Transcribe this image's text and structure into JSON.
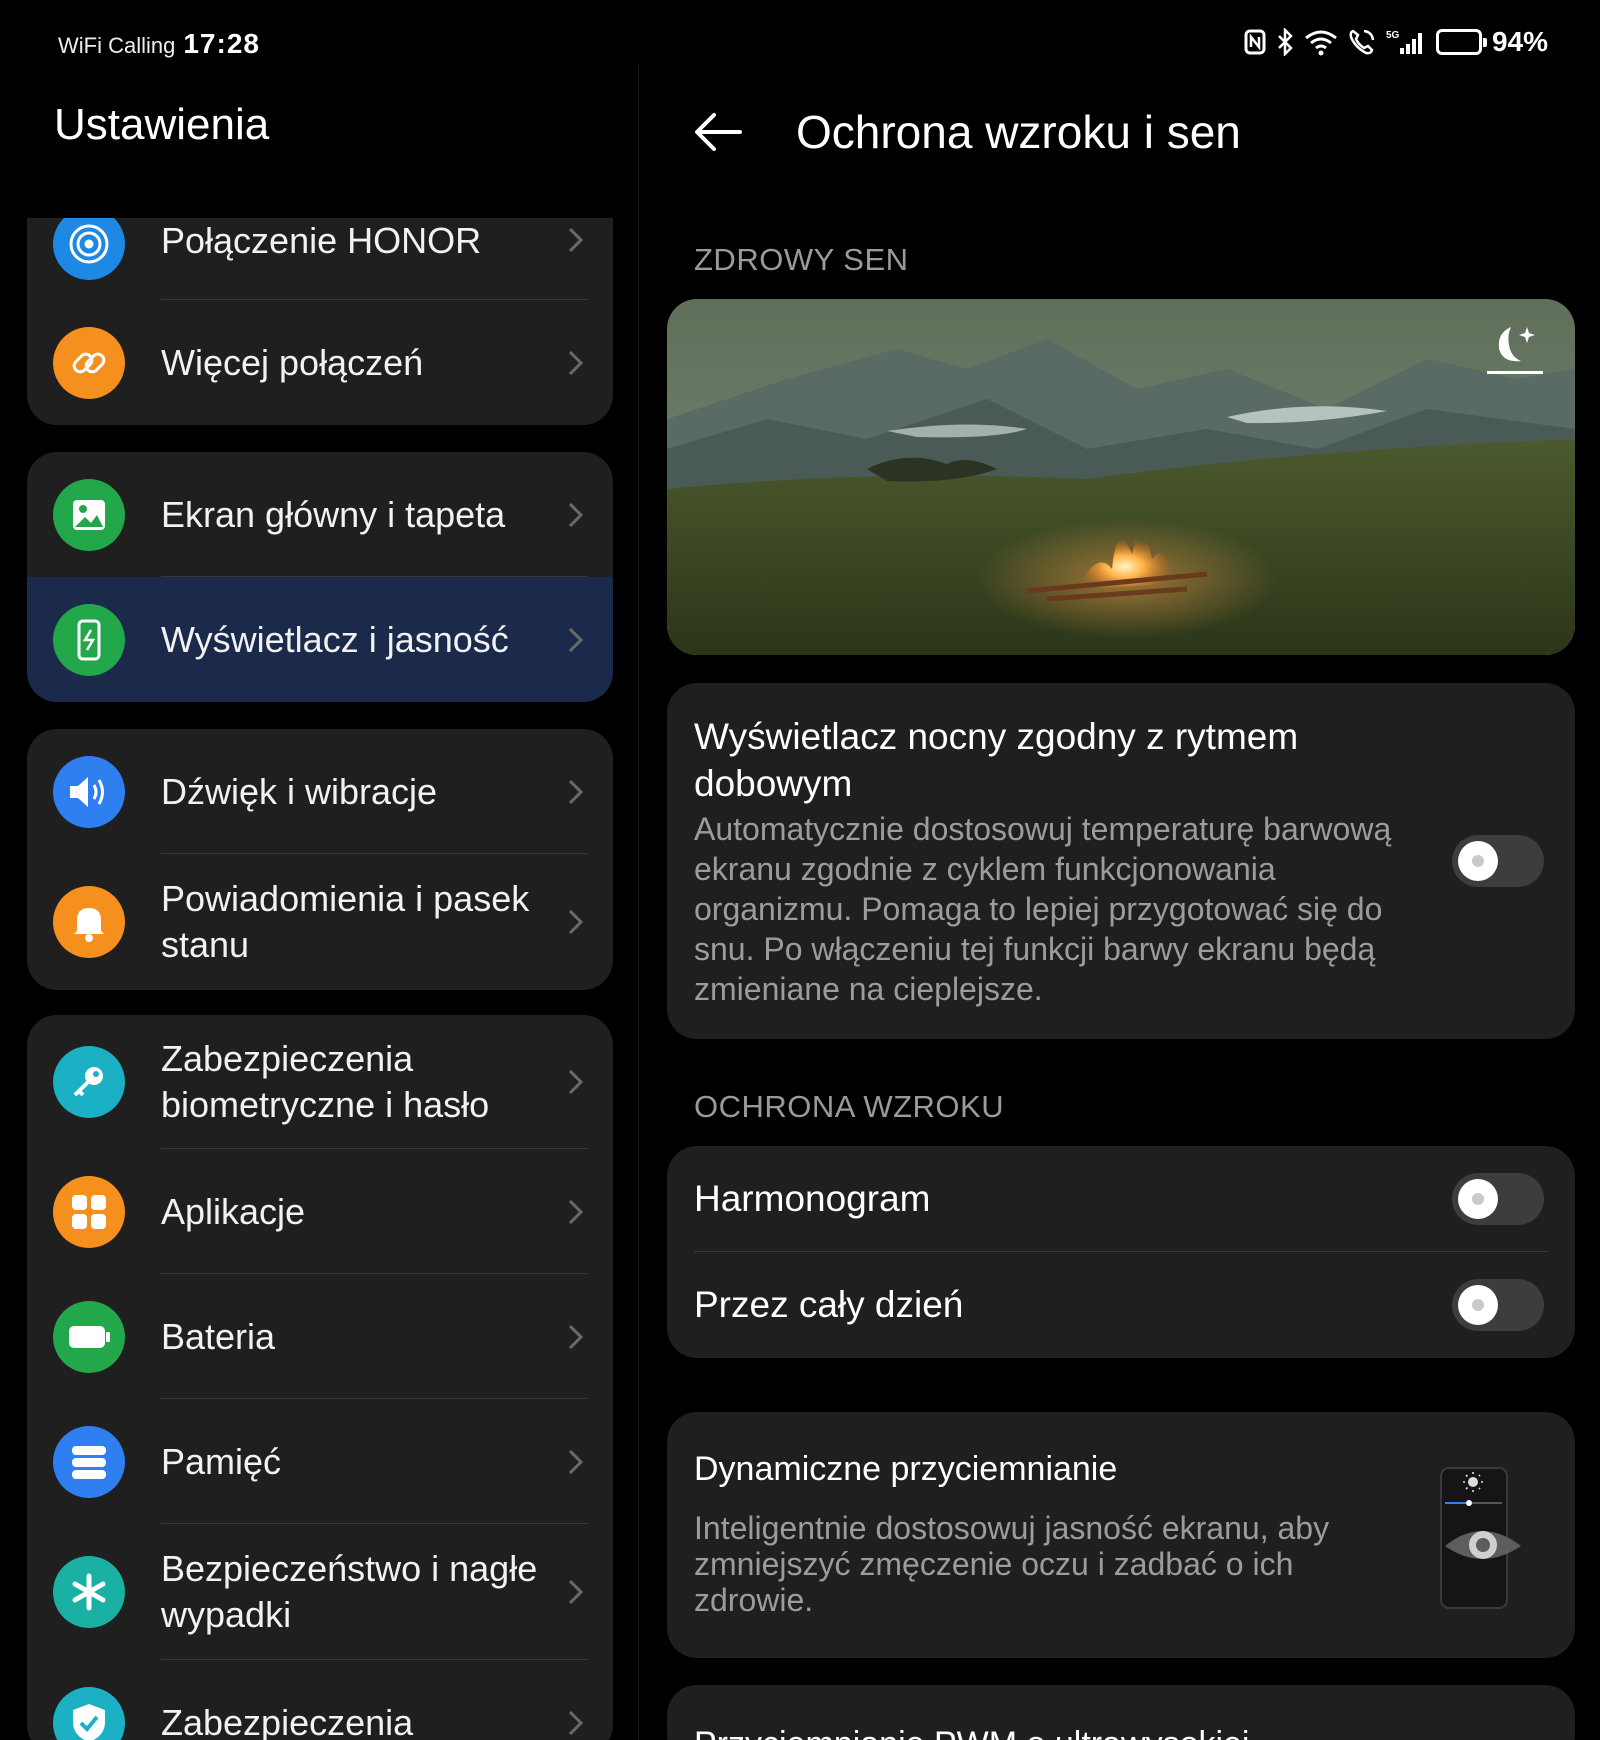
{
  "status_bar": {
    "carrier": "WiFi Calling",
    "time": "17:28",
    "battery_percent": "94%",
    "battery_level": 0.94
  },
  "left": {
    "title": "Ustawienia",
    "items": [
      {
        "label": "Połączenie HONOR",
        "icon": "honor-connect-icon",
        "color": "#1e88e5"
      },
      {
        "label": "Więcej połączeń",
        "icon": "link-icon",
        "color": "#f5901e"
      },
      {
        "label": "Ekran główny i tapeta",
        "icon": "image-icon",
        "color": "#22a84a"
      },
      {
        "label": "Wyświetlacz i jasność",
        "icon": "display-brightness-icon",
        "color": "#22a84a",
        "selected": true
      },
      {
        "label": "Dźwięk i wibracje",
        "icon": "speaker-icon",
        "color": "#2f7ff0"
      },
      {
        "label": "Powiadomienia i pasek stanu",
        "icon": "bell-icon",
        "color": "#f5901e"
      },
      {
        "label": "Zabezpieczenia biometryczne i hasło",
        "icon": "key-icon",
        "color": "#1bb0c4"
      },
      {
        "label": "Aplikacje",
        "icon": "apps-grid-icon",
        "color": "#f5901e"
      },
      {
        "label": "Bateria",
        "icon": "battery-icon",
        "color": "#22a84a"
      },
      {
        "label": "Pamięć",
        "icon": "storage-icon",
        "color": "#2f7ff0"
      },
      {
        "label": "Bezpieczeństwo i nagłe wypadki",
        "icon": "asterisk-icon",
        "color": "#1bb0a4"
      },
      {
        "label": "Zabezpieczenia",
        "icon": "shield-check-icon",
        "color": "#1bb0c4"
      }
    ]
  },
  "right": {
    "title": "Ochrona wzroku i sen",
    "section_sleep": "ZDROWY SEN",
    "night_display": {
      "title": "Wyświetlacz nocny zgodny z rytmem dobowym",
      "description": "Automatycznie dostosowuj temperaturę barwową ekranu zgodnie z cyklem funkcjonowania organizmu. Pomaga to lepiej przygotować się do snu. Po włączeniu tej funkcji barwy ekranu będą zmieniane na cieplejsze.",
      "enabled": false
    },
    "section_eye": "OCHRONA WZROKU",
    "harmonogram": {
      "label": "Harmonogram",
      "enabled": false
    },
    "all_day": {
      "label": "Przez cały dzień",
      "enabled": false
    },
    "dynamic_dimming": {
      "title": "Dynamiczne przyciemnianie",
      "description": "Inteligentnie dostosowuj jasność ekranu, aby zmniejszyć zmęczenie oczu i zadbać o ich zdrowie."
    },
    "pwm_partial": "Przyciemnianie PWM o ultrawysokiej"
  },
  "colors": {
    "background": "#000000",
    "card": "#1f1f1f",
    "selected_row": "#1b2a4a",
    "secondary_text": "#9c9c9c"
  }
}
